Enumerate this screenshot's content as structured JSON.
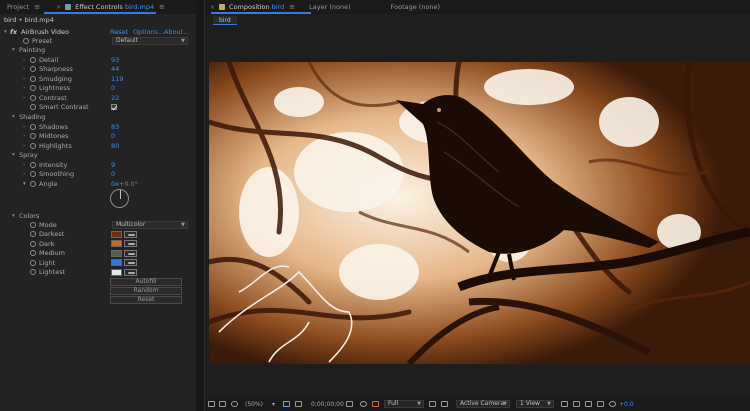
{
  "left_tabs": {
    "project": "Project",
    "effect_controls": "Effect Controls",
    "effect_controls_file": "bird.mp4"
  },
  "header": "bird • bird.mp4",
  "effect": {
    "fx": "fx",
    "name": "AirBrush Video",
    "reset": "Reset",
    "options": "Options...",
    "about": "About..."
  },
  "preset": {
    "label": "Preset",
    "value": "Default"
  },
  "painting": {
    "title": "Painting",
    "detail": {
      "label": "Detail",
      "value": "93"
    },
    "sharpness": {
      "label": "Sharpness",
      "value": "44"
    },
    "smudging": {
      "label": "Smudging",
      "value": "119"
    },
    "lightness": {
      "label": "Lightness",
      "value": "0"
    },
    "contrast": {
      "label": "Contrast",
      "value": "22"
    },
    "smart_contrast": {
      "label": "Smart Contrast",
      "checked": true
    }
  },
  "shading": {
    "title": "Shading",
    "shadows": {
      "label": "Shadows",
      "value": "83"
    },
    "midtones": {
      "label": "Midtones",
      "value": "0"
    },
    "highlights": {
      "label": "Highlights",
      "value": "80"
    }
  },
  "spray": {
    "title": "Spray",
    "intensity": {
      "label": "Intensity",
      "value": "9"
    },
    "smoothing": {
      "label": "Smoothing",
      "value": "0"
    },
    "angle": {
      "label": "Angle",
      "value": "0x+0.0°"
    }
  },
  "colors": {
    "title": "Colors",
    "mode": {
      "label": "Mode",
      "value": "Multicolor"
    },
    "items": [
      {
        "label": "Darkest",
        "color": "#6b2e12"
      },
      {
        "label": "Dark",
        "color": "#c86a1e"
      },
      {
        "label": "Medium",
        "color": "#5a5a5a"
      },
      {
        "label": "Light",
        "color": "#2f78d6"
      },
      {
        "label": "Lightest",
        "color": "#dfeaf0"
      }
    ],
    "buttons": {
      "autofill": "Autofill",
      "random": "Random",
      "reset": "Reset"
    }
  },
  "right_tabs": {
    "composition": "Composition",
    "composition_name": "bird",
    "layer": "Layer (none)",
    "footage": "Footage (none)"
  },
  "comp_subtab": "bird",
  "footer": {
    "zoom": "(50%)",
    "timecode": "0;00;00;00",
    "resolution": "Full",
    "camera": "Active Camera",
    "views": "1 View",
    "exposure": "+0,0"
  },
  "theme": {
    "accent": "#3a7bd5",
    "value_blue": "#3d8ef0",
    "panel_bg": "#232323"
  }
}
